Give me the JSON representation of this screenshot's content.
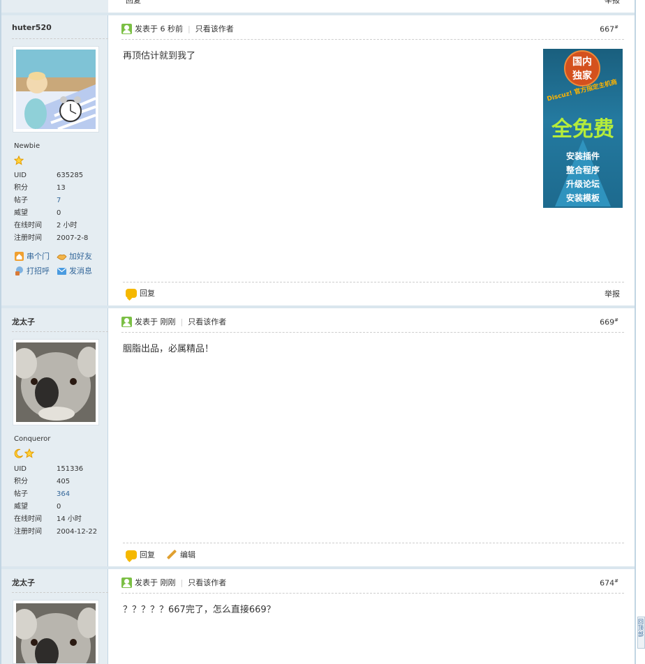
{
  "prev_footer": {
    "reply": "回复",
    "report": "举报"
  },
  "ad": {
    "circle": "国内\n独家",
    "sub": "Discuz! 官方指定主机商",
    "big": "全免费",
    "lines": [
      "安装插件",
      "整合程序",
      "升级论坛",
      "安装模板"
    ]
  },
  "posts": [
    {
      "author": "huter520",
      "rank": "Newbie",
      "stars": [
        "star-icon"
      ],
      "stats": [
        {
          "k": "UID",
          "v": "635285"
        },
        {
          "k": "积分",
          "v": "13"
        },
        {
          "k": "帖子",
          "v": "7"
        },
        {
          "k": "威望",
          "v": "0"
        },
        {
          "k": "在线时间",
          "v": "2 小时"
        },
        {
          "k": "注册时间",
          "v": "2007-2-8"
        }
      ],
      "actions": [
        "串个门",
        "加好友",
        "打招呼",
        "发消息"
      ],
      "posted": "发表于 6 秒前",
      "only_author": "只看该作者",
      "floor": "667",
      "floor_mark": "#",
      "content": "再顶估计就到我了",
      "footer": [
        "回复"
      ],
      "report": "举报"
    },
    {
      "author": "龙太子",
      "rank": "Conqueror",
      "stars": [
        "moon-icon",
        "star-icon"
      ],
      "stats": [
        {
          "k": "UID",
          "v": "151336"
        },
        {
          "k": "积分",
          "v": "405"
        },
        {
          "k": "帖子",
          "v": "364"
        },
        {
          "k": "威望",
          "v": "0"
        },
        {
          "k": "在线时间",
          "v": "14 小时"
        },
        {
          "k": "注册时间",
          "v": "2004-12-22"
        }
      ],
      "posted": "发表于 刚刚",
      "only_author": "只看该作者",
      "floor": "669",
      "floor_mark": "#",
      "content": "胭脂出品，必属精品！",
      "footer": [
        "回复",
        "编辑"
      ]
    },
    {
      "author": "龙太子",
      "posted": "发表于 刚刚",
      "only_author": "只看该作者",
      "floor": "674",
      "floor_mark": "#",
      "content": "？？？？？667完了，怎么直接669？"
    }
  ],
  "back_top": "回顶部"
}
